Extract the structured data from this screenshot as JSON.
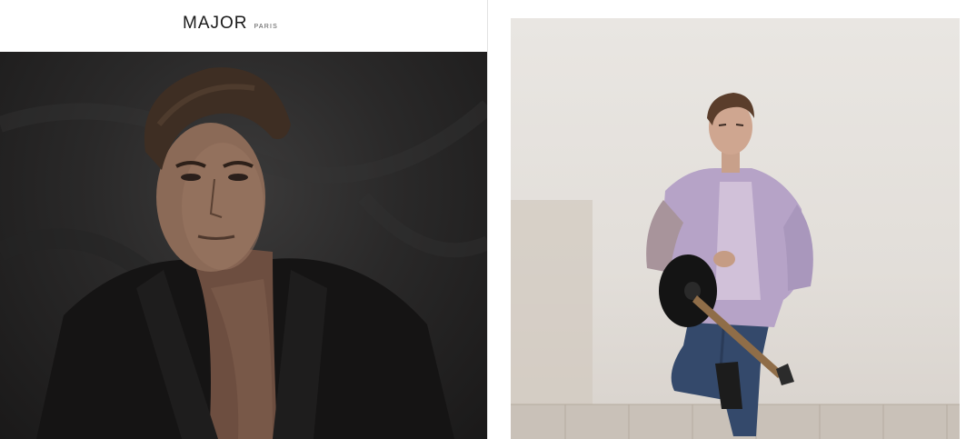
{
  "brand": {
    "name": "MAJOR",
    "city": "PARIS"
  },
  "left_photo": {
    "subject": "model-portrait-dark"
  },
  "right_photo": {
    "subject": "model-with-guitar"
  },
  "colors": {
    "left_bg": "#2a2929",
    "right_wall": "#e4e0db",
    "jacket_lilac": "#b6a3c7",
    "jeans_blue": "#34496b"
  }
}
